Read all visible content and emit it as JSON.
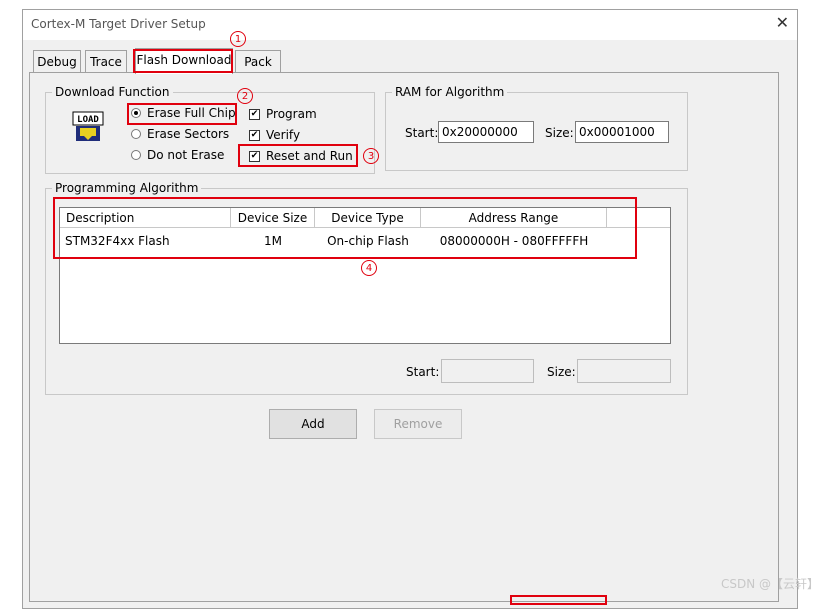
{
  "window": {
    "title": "Cortex-M Target Driver Setup"
  },
  "tabs": [
    {
      "label": "Debug"
    },
    {
      "label": "Trace"
    },
    {
      "label": "Flash Download"
    },
    {
      "label": "Pack"
    }
  ],
  "markers": {
    "m1": "1",
    "m2": "2",
    "m3": "3",
    "m4": "4"
  },
  "download_function": {
    "legend": "Download Function",
    "icon_text": "LOAD",
    "radios": [
      {
        "label": "Erase Full Chip",
        "selected": true
      },
      {
        "label": "Erase Sectors",
        "selected": false
      },
      {
        "label": "Do not Erase",
        "selected": false
      }
    ],
    "checks": [
      {
        "label": "Program",
        "checked": true
      },
      {
        "label": "Verify",
        "checked": true
      },
      {
        "label": "Reset and Run",
        "checked": true
      }
    ]
  },
  "ram_for_algorithm": {
    "legend": "RAM for Algorithm",
    "start_label": "Start:",
    "start_value": "0x20000000",
    "size_label": "Size:",
    "size_value": "0x00001000"
  },
  "programming_algorithm": {
    "legend": "Programming Algorithm",
    "columns": [
      "Description",
      "Device Size",
      "Device Type",
      "Address Range"
    ],
    "rows": [
      {
        "description": "STM32F4xx Flash",
        "device_size": "1M",
        "device_type": "On-chip Flash",
        "address_range": "08000000H - 080FFFFFH"
      }
    ],
    "start_label": "Start:",
    "start_value": "",
    "size_label": "Size:",
    "size_value": ""
  },
  "buttons": {
    "add": "Add",
    "remove": "Remove"
  },
  "watermark": "CSDN @【云轩】",
  "colors": {
    "highlight": "#e0000e",
    "dialog_bg": "#f0f0f0"
  }
}
